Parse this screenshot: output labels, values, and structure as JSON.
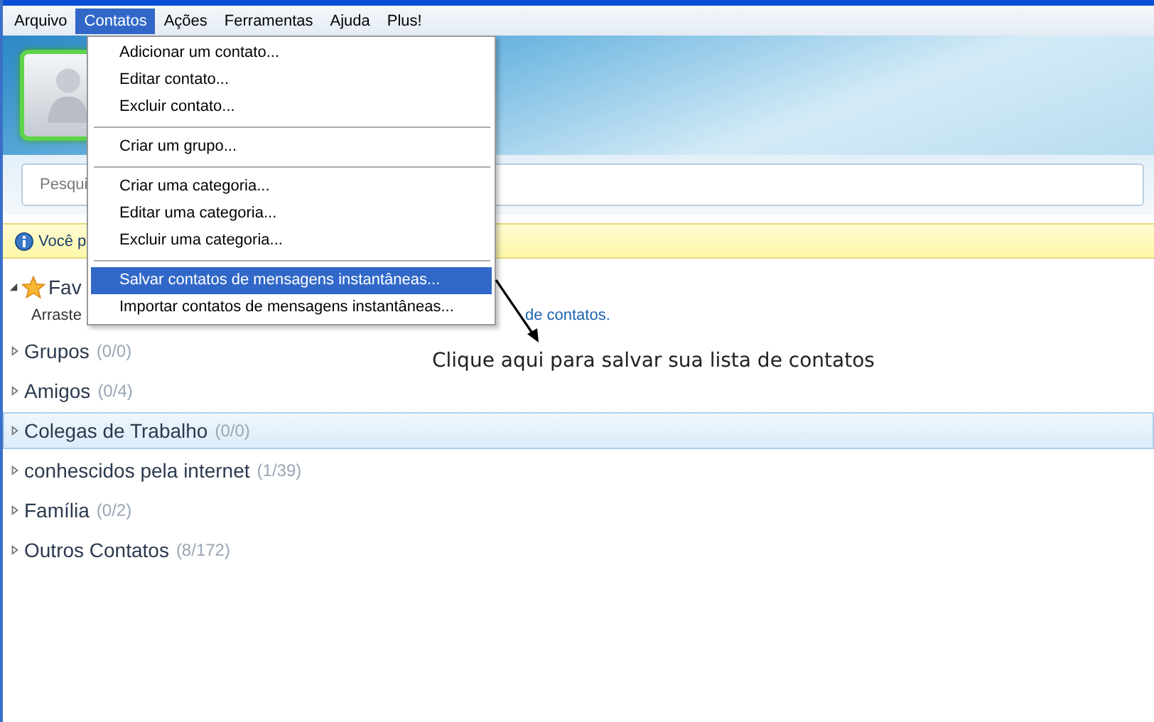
{
  "menubar": [
    {
      "label": "Arquivo",
      "selected": false
    },
    {
      "label": "Contatos",
      "selected": true
    },
    {
      "label": "Ações",
      "selected": false
    },
    {
      "label": "Ferramentas",
      "selected": false
    },
    {
      "label": "Ajuda",
      "selected": false
    },
    {
      "label": "Plus!",
      "selected": false
    }
  ],
  "search": {
    "placeholder": "Pesqui"
  },
  "info_bar": {
    "text": "Você p"
  },
  "favorites": {
    "label": "Fav",
    "expanded": true,
    "hint": "Arraste",
    "hint_link": "de contatos."
  },
  "groups": [
    {
      "name": "Grupos",
      "count": "(0/0)",
      "selected": false,
      "expanded": false
    },
    {
      "name": "Amigos",
      "count": "(0/4)",
      "selected": false,
      "expanded": false
    },
    {
      "name": "Colegas de Trabalho",
      "count": "(0/0)",
      "selected": true,
      "expanded": false
    },
    {
      "name": "conhescidos pela internet",
      "count": "(1/39)",
      "selected": false,
      "expanded": false
    },
    {
      "name": "Família",
      "count": "(0/2)",
      "selected": false,
      "expanded": false
    },
    {
      "name": "Outros Contatos",
      "count": "(8/172)",
      "selected": false,
      "expanded": false
    }
  ],
  "menu": [
    {
      "kind": "item",
      "label": "Adicionar um contato...",
      "selected": false
    },
    {
      "kind": "item",
      "label": "Editar contato...",
      "selected": false
    },
    {
      "kind": "item",
      "label": "Excluir contato...",
      "selected": false
    },
    {
      "kind": "separator"
    },
    {
      "kind": "item",
      "label": "Criar um grupo...",
      "selected": false
    },
    {
      "kind": "separator"
    },
    {
      "kind": "item",
      "label": "Criar uma categoria...",
      "selected": false
    },
    {
      "kind": "item",
      "label": "Editar uma categoria...",
      "selected": false
    },
    {
      "kind": "item",
      "label": "Excluir uma categoria...",
      "selected": false
    },
    {
      "kind": "separator"
    },
    {
      "kind": "item",
      "label": "Salvar contatos de mensagens instantâneas...",
      "selected": true
    },
    {
      "kind": "item",
      "label": "Importar contatos de mensagens instantâneas...",
      "selected": false
    }
  ],
  "annotation": "Clique aqui para salvar sua lista de contatos"
}
